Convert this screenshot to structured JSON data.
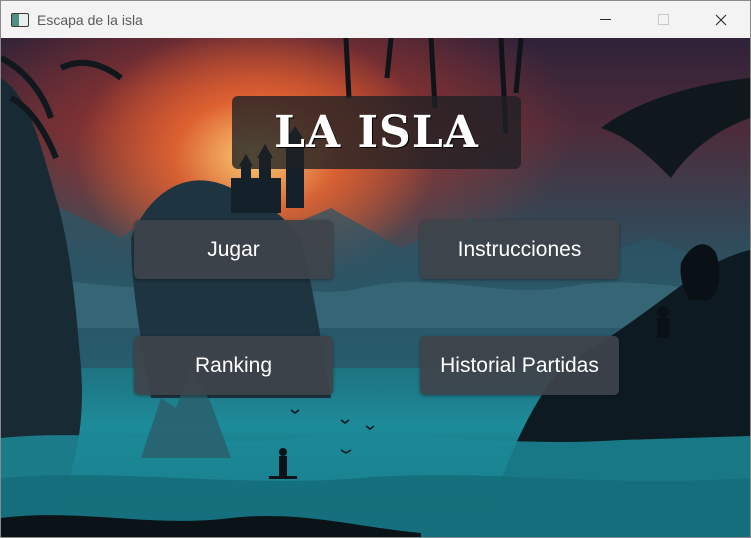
{
  "window": {
    "title": "Escapa de la isla",
    "icon": "app-window-icon",
    "controls": [
      "minimize",
      "maximize",
      "close"
    ]
  },
  "game": {
    "title": "LA ISLA",
    "background": "island-sunset-illustration"
  },
  "menu": {
    "jugar": "Jugar",
    "instrucciones": "Instrucciones",
    "ranking": "Ranking",
    "historial": "Historial Partidas"
  }
}
